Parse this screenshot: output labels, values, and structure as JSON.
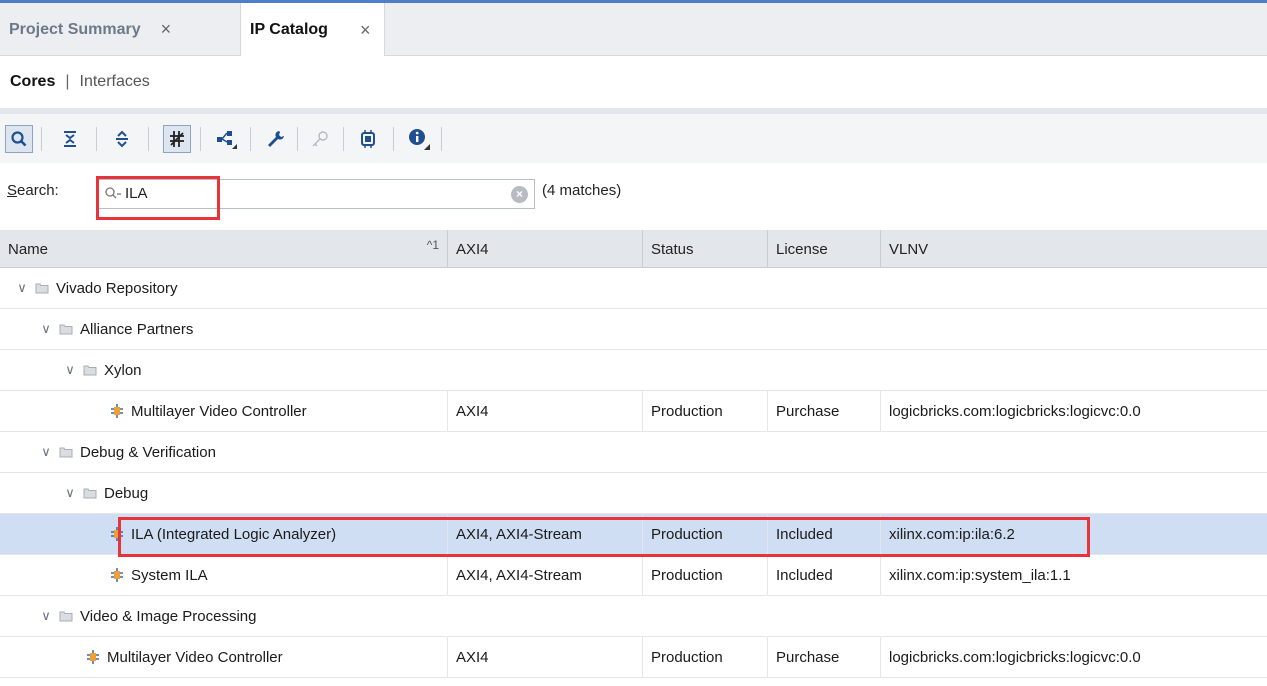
{
  "tabs": [
    {
      "label": "Project Summary",
      "close": "×",
      "active": false
    },
    {
      "label": "IP Catalog",
      "close": "×",
      "active": true
    }
  ],
  "subtabs": {
    "cores": "Cores",
    "separator": "|",
    "interfaces": "Interfaces"
  },
  "toolbar": {
    "icons": [
      "search-icon",
      "collapse-all-icon",
      "expand-all-icon",
      "filter-icon",
      "hierarchy-icon",
      "customize-ip-icon",
      "key-icon",
      "chip-icon",
      "info-icon"
    ]
  },
  "search": {
    "label_prefix": "S",
    "label_rest": "earch:",
    "value": "ILA",
    "matches": "(4 matches)"
  },
  "table": {
    "columns": {
      "name": "Name",
      "sort": "^1",
      "axi4": "AXI4",
      "status": "Status",
      "license": "License",
      "vlnv": "VLNV"
    },
    "rows": [
      {
        "level": 0,
        "type": "folder",
        "name": "Vivado Repository",
        "axi4": "",
        "status": "",
        "license": "",
        "vlnv": ""
      },
      {
        "level": 1,
        "type": "folder",
        "name": "Alliance Partners",
        "axi4": "",
        "status": "",
        "license": "",
        "vlnv": ""
      },
      {
        "level": 2,
        "type": "folder",
        "name": "Xylon",
        "axi4": "",
        "status": "",
        "license": "",
        "vlnv": ""
      },
      {
        "level": 3,
        "type": "ip",
        "name": "Multilayer Video Controller",
        "axi4": "AXI4",
        "status": "Production",
        "license": "Purchase",
        "vlnv": "logicbricks.com:logicbricks:logicvc:0.0"
      },
      {
        "level": 1,
        "type": "folder",
        "name": "Debug & Verification",
        "axi4": "",
        "status": "",
        "license": "",
        "vlnv": ""
      },
      {
        "level": 2,
        "type": "folder",
        "name": "Debug",
        "axi4": "",
        "status": "",
        "license": "",
        "vlnv": ""
      },
      {
        "level": 3,
        "type": "ip",
        "name": "ILA (Integrated Logic Analyzer)",
        "axi4": "AXI4, AXI4-Stream",
        "status": "Production",
        "license": "Included",
        "vlnv": "xilinx.com:ip:ila:6.2",
        "selected": true
      },
      {
        "level": 3,
        "type": "ip",
        "name": "System ILA",
        "axi4": "AXI4, AXI4-Stream",
        "status": "Production",
        "license": "Included",
        "vlnv": "xilinx.com:ip:system_ila:1.1"
      },
      {
        "level": 1,
        "type": "folder",
        "name": "Video & Image Processing",
        "axi4": "",
        "status": "",
        "license": "",
        "vlnv": ""
      },
      {
        "level": 2,
        "type": "ip",
        "name": "Multilayer Video Controller",
        "axi4": "AXI4",
        "status": "Production",
        "license": "Purchase",
        "vlnv": "logicbricks.com:logicbricks:logicvc:0.0"
      }
    ]
  },
  "colors": {
    "accent": "#4d7fc9",
    "highlight": "#e8333a",
    "selected_row": "#cfdef3",
    "ip_icon": "#f0a030"
  }
}
